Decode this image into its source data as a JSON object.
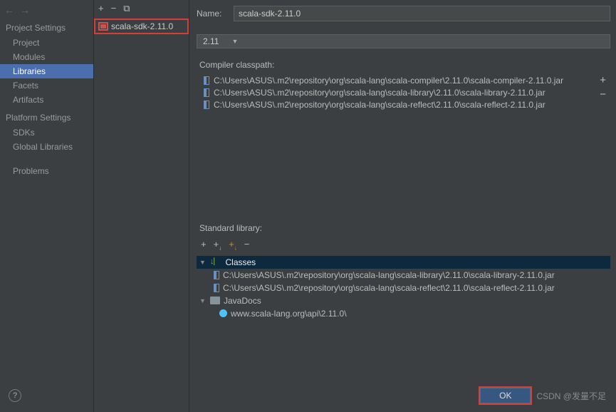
{
  "sidebar": {
    "section1_title": "Project Settings",
    "items1": [
      "Project",
      "Modules",
      "Libraries",
      "Facets",
      "Artifacts"
    ],
    "selected1": "Libraries",
    "section2_title": "Platform Settings",
    "items2": [
      "SDKs",
      "Global Libraries"
    ],
    "problems": "Problems"
  },
  "library_list": {
    "items": [
      "scala-sdk-2.11.0"
    ]
  },
  "main": {
    "name_label": "Name:",
    "name_value": "scala-sdk-2.11.0",
    "version_dropdown": "2.11",
    "compiler_classpath_label": "Compiler classpath:",
    "classpath_files": [
      "C:\\Users\\ASUS\\.m2\\repository\\org\\scala-lang\\scala-compiler\\2.11.0\\scala-compiler-2.11.0.jar",
      "C:\\Users\\ASUS\\.m2\\repository\\org\\scala-lang\\scala-library\\2.11.0\\scala-library-2.11.0.jar",
      "C:\\Users\\ASUS\\.m2\\repository\\org\\scala-lang\\scala-reflect\\2.11.0\\scala-reflect-2.11.0.jar"
    ],
    "standard_library_label": "Standard library:",
    "tree": {
      "classes_label": "Classes",
      "class_files": [
        "C:\\Users\\ASUS\\.m2\\repository\\org\\scala-lang\\scala-library\\2.11.0\\scala-library-2.11.0.jar",
        "C:\\Users\\ASUS\\.m2\\repository\\org\\scala-lang\\scala-reflect\\2.11.0\\scala-reflect-2.11.0.jar"
      ],
      "javadocs_label": "JavaDocs",
      "javadocs_url": "www.scala-lang.org\\api\\2.11.0\\"
    }
  },
  "footer": {
    "ok_label": "OK",
    "watermark": "CSDN @发量不足"
  }
}
